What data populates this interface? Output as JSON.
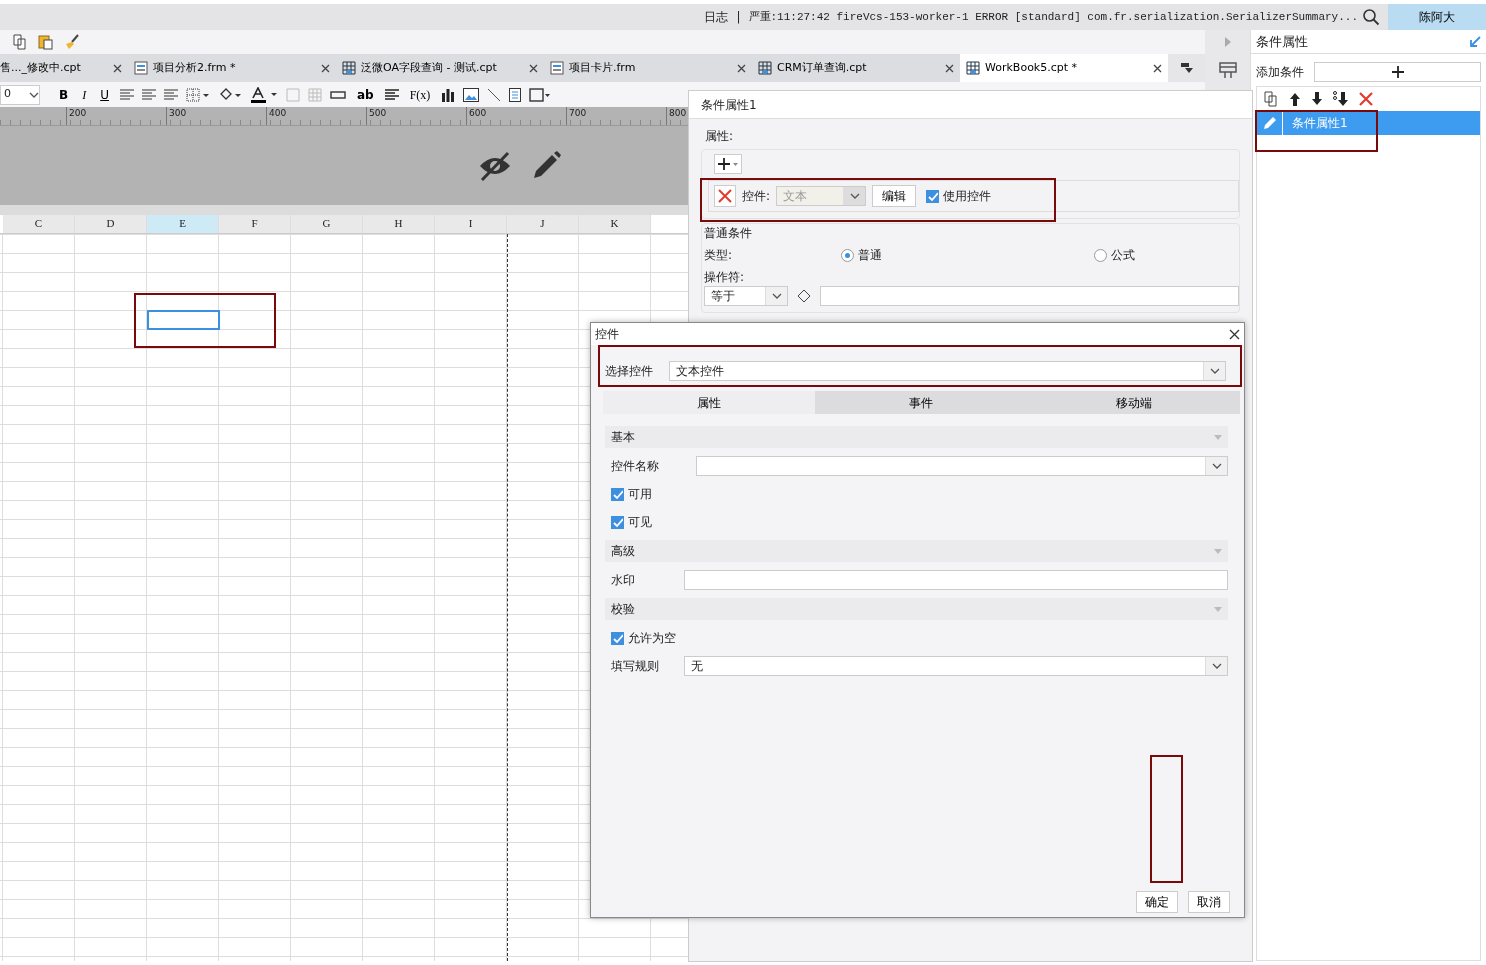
{
  "status_bar": {
    "log_label": "日志",
    "separator": "|",
    "message": "严重:11:27:42 fireVcs-153-worker-1 ERROR [standard] com.fr.serialization.SerializerSummary...",
    "user": "陈阿大"
  },
  "tabs": [
    {
      "label": "售..._修改中.cpt",
      "selected": false
    },
    {
      "label": "项目分析2.frm *",
      "kind": "form",
      "selected": false
    },
    {
      "label": "泛微OA字段查询 - 测试.cpt",
      "kind": "report",
      "selected": false
    },
    {
      "label": "项目卡片.frm",
      "kind": "form",
      "selected": false
    },
    {
      "label": "CRM订单查询.cpt",
      "kind": "report",
      "selected": false
    },
    {
      "label": "WorkBook5.cpt *",
      "kind": "report",
      "selected": true
    }
  ],
  "toolbar": {
    "font_size": "0",
    "bold": "B",
    "italic": "I",
    "underline": "U",
    "text_widget": "ab",
    "formula": "F(x)"
  },
  "ruler": {
    "labels": [
      "200",
      "300",
      "400",
      "500",
      "600",
      "700",
      "800"
    ]
  },
  "sheet": {
    "columns": [
      {
        "label": "C",
        "selected": false
      },
      {
        "label": "D",
        "selected": false
      },
      {
        "label": "E",
        "selected": true
      },
      {
        "label": "F",
        "selected": false
      },
      {
        "label": "G",
        "selected": false
      },
      {
        "label": "H",
        "selected": false
      },
      {
        "label": "I",
        "selected": false
      },
      {
        "label": "J",
        "selected": false
      },
      {
        "label": "K",
        "selected": false
      }
    ]
  },
  "condition_editor": {
    "title": "条件属性1",
    "attributes_label": "属性:",
    "control_row": {
      "label": "控件:",
      "value": "文本",
      "disabled": true,
      "edit_button": "编辑",
      "use_control": {
        "label": "使用控件",
        "checked": true
      }
    },
    "condition_group": {
      "title": "普通条件",
      "type_label": "类型:",
      "types": [
        {
          "label": "普通",
          "selected": true
        },
        {
          "label": "公式",
          "selected": false
        }
      ],
      "operator_label": "操作符:",
      "operator": "等于"
    }
  },
  "control_dialog": {
    "title": "控件",
    "select_label": "选择控件",
    "selected_control": "文本控件",
    "tabs": [
      {
        "label": "属性",
        "selected": true
      },
      {
        "label": "事件",
        "selected": false
      },
      {
        "label": "移动端",
        "selected": false
      }
    ],
    "sections": [
      {
        "title": "基本",
        "rows": [
          {
            "kind": "combo",
            "label": "控件名称"
          },
          {
            "kind": "checkbox",
            "label": "可用",
            "checked": true
          },
          {
            "kind": "checkbox",
            "label": "可见",
            "checked": true
          }
        ]
      },
      {
        "title": "高级",
        "rows": [
          {
            "kind": "text",
            "label": "水印"
          }
        ]
      },
      {
        "title": "校验",
        "rows": [
          {
            "kind": "checkbox",
            "label": "允许为空",
            "checked": true
          },
          {
            "kind": "combo",
            "label": "填写规则",
            "value": "无"
          }
        ]
      }
    ],
    "buttons": [
      "确定",
      "取消"
    ]
  },
  "side_panel": {
    "title": "条件属性",
    "add_label": "添加条件",
    "conditions": [
      {
        "label": "条件属性1",
        "selected": true
      }
    ]
  }
}
